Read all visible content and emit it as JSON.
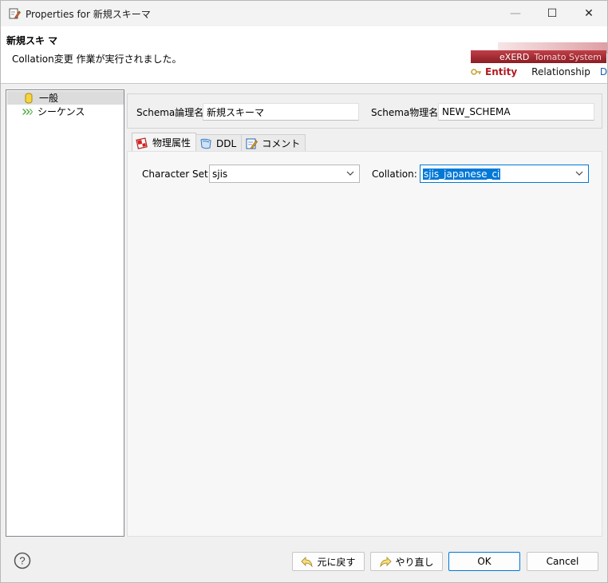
{
  "window": {
    "title": "Properties for 新規スキーマ",
    "minimize": "—",
    "maximize": "☐",
    "close": "✕"
  },
  "header": {
    "title": "新規スキ マ",
    "message": "Collation変更 作業が実行されました。",
    "banner": {
      "product": "eXERD",
      "company": "Tomato System",
      "tabs": [
        "Entity",
        "Relationship",
        "Diag"
      ]
    }
  },
  "tree": {
    "items": [
      {
        "label": "一般",
        "icon": "database-icon",
        "selected": true
      },
      {
        "label": "シーケンス",
        "icon": "sequence-icon",
        "selected": false
      }
    ]
  },
  "schema": {
    "logical_label": "Schema論理名",
    "logical_value": "新規スキーマ",
    "physical_label": "Schema物理名",
    "physical_value": "NEW_SCHEMA"
  },
  "tabs": [
    {
      "label": "物理属性",
      "icon": "physical-attr-icon",
      "active": true
    },
    {
      "label": "DDL",
      "icon": "ddl-icon",
      "active": false
    },
    {
      "label": "コメント",
      "icon": "comment-icon",
      "active": false
    }
  ],
  "physical": {
    "charset_label": "Character Set:",
    "charset_value": "sjis",
    "collation_label": "Collation:",
    "collation_value": "sjis_japanese_ci"
  },
  "buttons": {
    "help": "?",
    "undo": "元に戻す",
    "redo": "やり直し",
    "ok": "OK",
    "cancel": "Cancel"
  },
  "colors": {
    "accent": "#0078d7",
    "brand": "#a8202a"
  }
}
